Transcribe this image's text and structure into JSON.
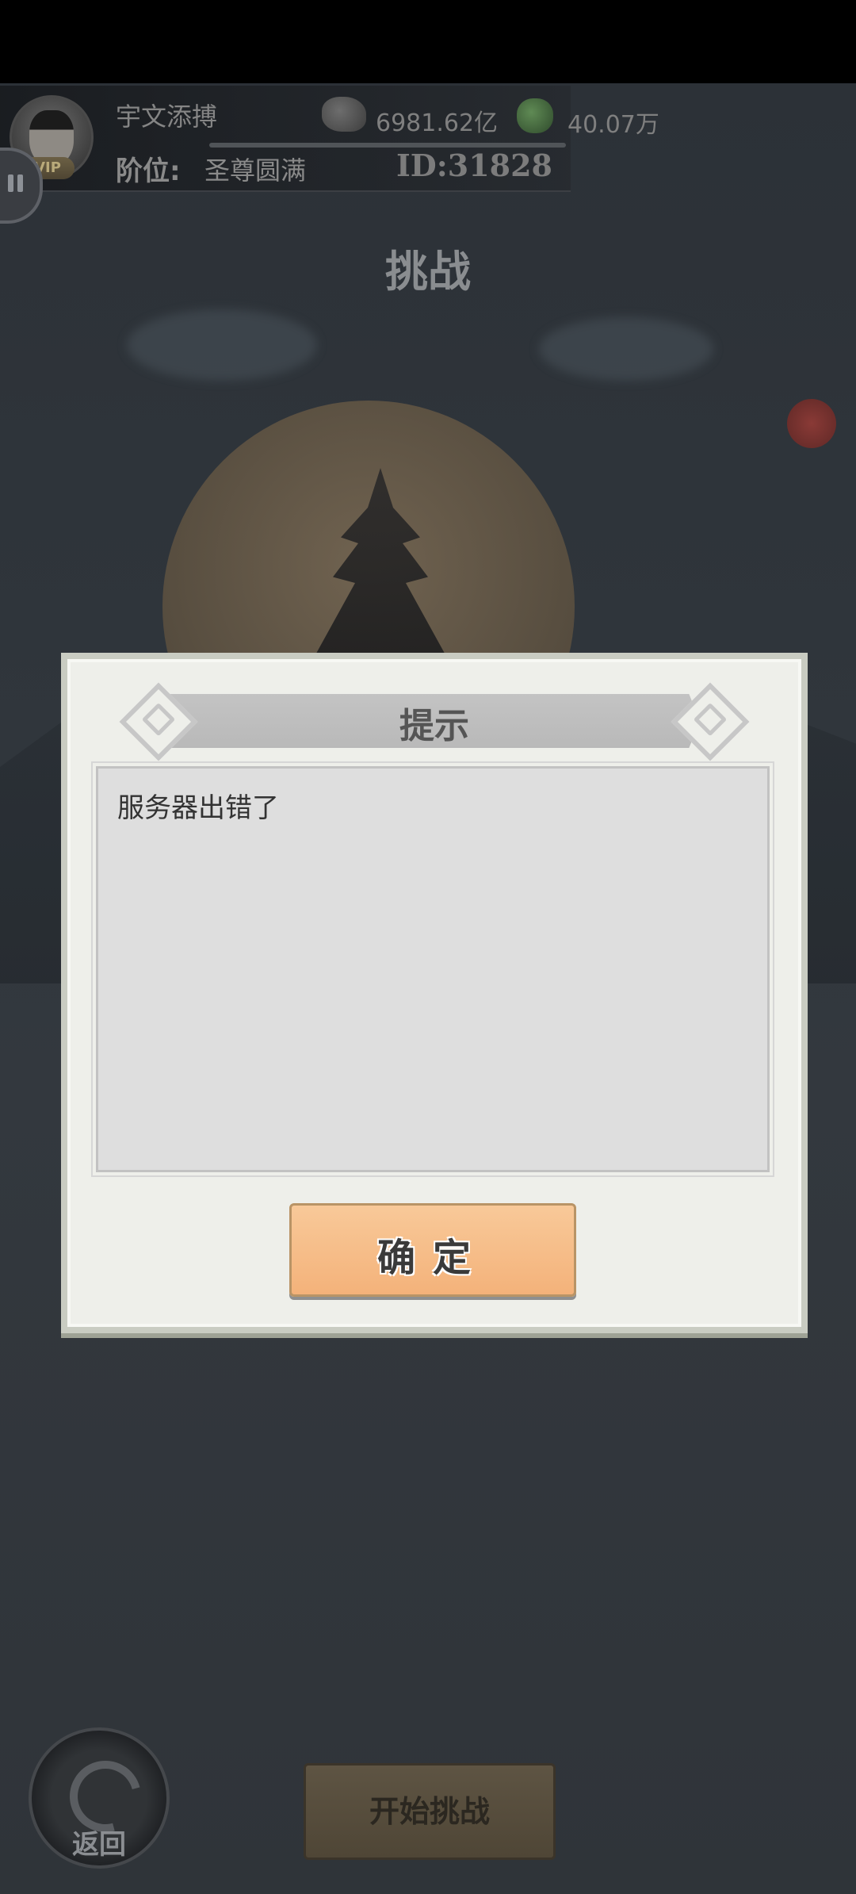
{
  "header": {
    "player_name": "宇文添搏",
    "vip_badge": "VIP",
    "rank_label": "阶位:",
    "rank_value": "圣尊圆满",
    "player_id": "ID:31828",
    "ore_value": "6981.62亿",
    "jade_value": "40.07万"
  },
  "page": {
    "title": "挑战"
  },
  "dialog": {
    "title": "提示",
    "message": "服务器出错了",
    "confirm_label": "确定"
  },
  "bottom": {
    "back_label": "返回",
    "start_label": "开始挑战"
  },
  "icons": {
    "pause": "pause-icon",
    "ore": "ore-icon",
    "jade": "jade-icon",
    "back": "swirl-icon"
  },
  "colors": {
    "dialog_bg": "#eeefea",
    "confirm_bg": "#f4b27a",
    "scene_bg": "#2f353b"
  }
}
